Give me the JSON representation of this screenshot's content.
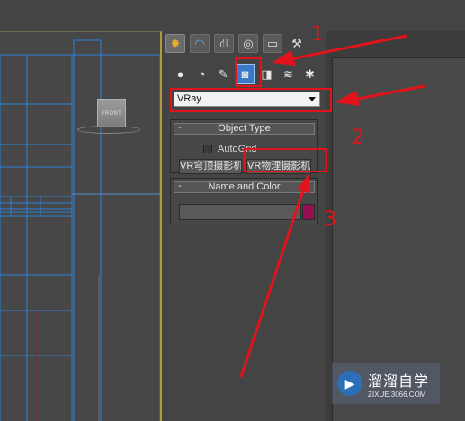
{
  "viewport": {
    "viewcube_label": "FRONT"
  },
  "command_panel": {
    "tabs": [
      "create-tab",
      "modify-tab",
      "hierarchy-tab",
      "motion-tab",
      "display-tab",
      "utilities-tab"
    ],
    "subtabs": [
      "geometry",
      "shapes",
      "lights",
      "cameras",
      "helpers",
      "space-warps",
      "systems"
    ],
    "active_tab": "create-tab",
    "active_subtab": "cameras",
    "category_dropdown": {
      "value": "VRay"
    },
    "object_type": {
      "title": "Object Type",
      "collapse_glyph": "-",
      "autogrid_label": "AutoGrid",
      "buttons": [
        "VR穹顶摄影机",
        "VR物理摄影机"
      ]
    },
    "name_and_color": {
      "title": "Name and Color",
      "collapse_glyph": "-",
      "name_value": "",
      "color": "#93114e"
    }
  },
  "annotations": {
    "numbers": [
      "1",
      "2",
      "3"
    ],
    "color": "#e2141b"
  },
  "watermark": {
    "brand": "溜溜自学",
    "url": "ZIXUE.3066.COM"
  }
}
